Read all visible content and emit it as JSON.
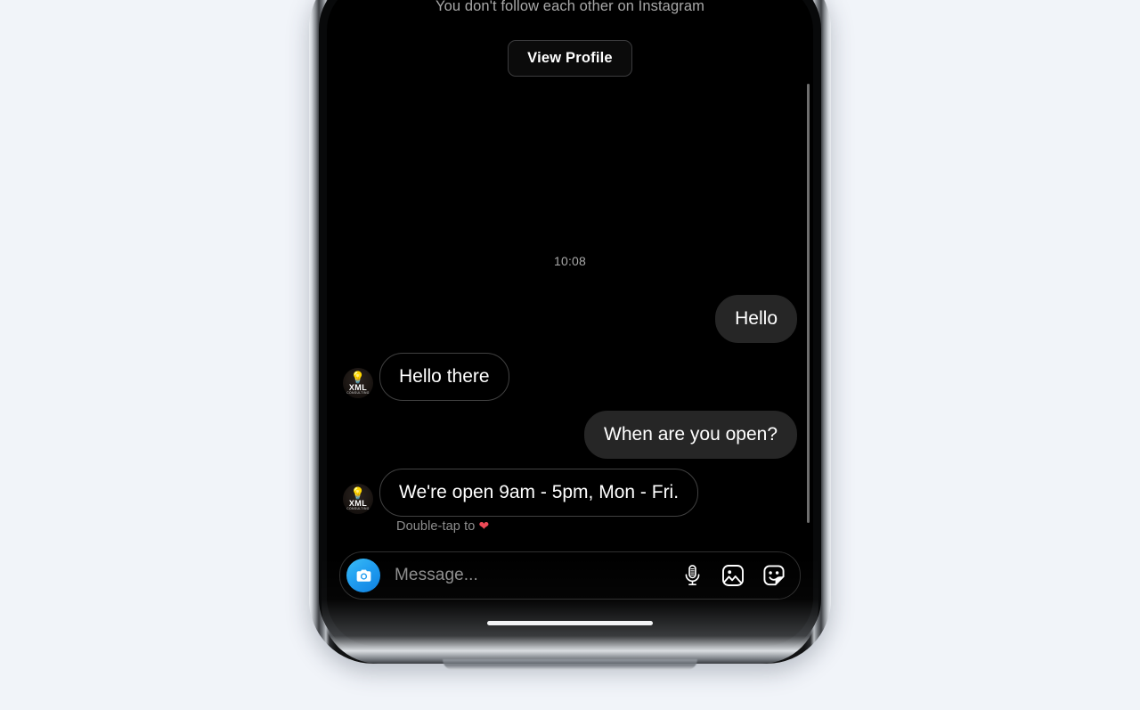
{
  "page": {
    "background_color": "#f1f4f9"
  },
  "device": {
    "name": "smartphone-mockup",
    "frame_color": "#c9ced4",
    "screen_background": "#000000"
  },
  "profile_header": {
    "follow_note": "You don't follow each other on Instagram",
    "view_profile_label": "View Profile"
  },
  "thread": {
    "timestamp": "10:08",
    "double_tap_hint_text": "Double-tap to ",
    "double_tap_hint_emoji": "❤",
    "avatar": {
      "bulb_icon": "lightbulb-icon",
      "brand_line1": "XML",
      "brand_line2": "CONSULTING",
      "accent_color": "#d68a35"
    },
    "messages": [
      {
        "id": "msg-1",
        "direction": "outgoing",
        "text": "Hello",
        "bubble_color": "#262626"
      },
      {
        "id": "msg-2",
        "direction": "incoming",
        "text": "Hello there",
        "bubble_border_color": "#414141",
        "has_avatar": true
      },
      {
        "id": "msg-3",
        "direction": "outgoing",
        "text": "When are you open?",
        "bubble_color": "#262626"
      },
      {
        "id": "msg-4",
        "direction": "incoming",
        "text": "We're open 9am - 5pm, Mon - Fri.",
        "bubble_border_color": "#414141",
        "has_avatar": true
      }
    ]
  },
  "composer": {
    "camera_icon": "camera-icon",
    "camera_color": "#1e9cf0",
    "placeholder": "Message...",
    "value": "",
    "actions": [
      {
        "icon": "microphone-icon",
        "label": "Voice message"
      },
      {
        "icon": "image-icon",
        "label": "Photo"
      },
      {
        "icon": "sticker-icon",
        "label": "Sticker"
      }
    ]
  },
  "system": {
    "home_indicator": "home-indicator"
  }
}
